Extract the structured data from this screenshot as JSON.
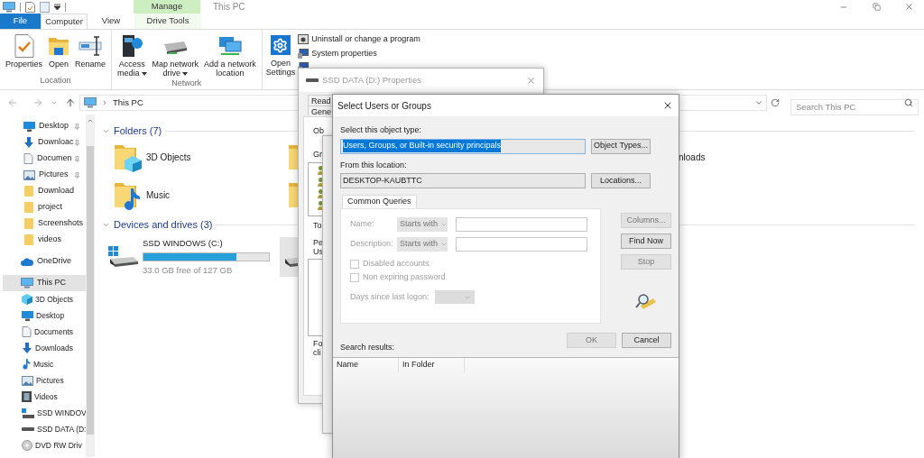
{
  "explorer": {
    "title": "This PC",
    "context_group": "Manage",
    "tabs": [
      {
        "label": "File",
        "kind": "file",
        "selected": false
      },
      {
        "label": "Computer",
        "kind": "tab",
        "selected": true
      },
      {
        "label": "View",
        "kind": "tab",
        "selected": false
      },
      {
        "label": "Drive Tools",
        "kind": "context",
        "selected": false
      }
    ],
    "ribbon_groups": [
      {
        "label": "Location",
        "commands": [
          {
            "label": "Properties",
            "kind": "properties",
            "has_menu": false
          },
          {
            "label": "Open",
            "kind": "open",
            "has_menu": false
          },
          {
            "label": "Rename",
            "kind": "rename",
            "has_menu": false
          }
        ]
      },
      {
        "label": "Network",
        "commands": [
          {
            "label": "Access\nmedia",
            "kind": "media",
            "has_menu": true
          },
          {
            "label": "Map network\ndrive",
            "kind": "map_drive",
            "has_menu": true
          },
          {
            "label": "Add a network\nlocation",
            "kind": "network_location",
            "has_menu": false
          }
        ]
      }
    ],
    "settings_command": "Open\nSettings",
    "system_commands": [
      {
        "label": "Uninstall or change a program",
        "kind": "uninstall"
      },
      {
        "label": "System properties",
        "kind": "system"
      }
    ],
    "address": "This PC",
    "search_placeholder": "Search This PC",
    "quick_access": [
      {
        "label": "Desktop",
        "kind": "desktop",
        "pinned": true
      },
      {
        "label": "Downloac",
        "kind": "download",
        "pinned": true
      },
      {
        "label": "Documen",
        "kind": "document",
        "pinned": true
      },
      {
        "label": "Pictures",
        "kind": "pictures",
        "pinned": true
      },
      {
        "label": "Download",
        "kind": "folder",
        "pinned": false
      },
      {
        "label": "project",
        "kind": "folder",
        "pinned": false
      },
      {
        "label": "Screenshots",
        "kind": "folder",
        "pinned": false
      },
      {
        "label": "videos",
        "kind": "folder",
        "pinned": false
      }
    ],
    "nav_roots": [
      {
        "label": "OneDrive",
        "kind": "cloud",
        "selected": false
      },
      {
        "label": "This PC",
        "kind": "pc",
        "selected": true,
        "children": [
          {
            "label": "3D Objects",
            "kind": "cube",
            "selected": false
          },
          {
            "label": "Desktop",
            "kind": "desktop",
            "selected": false
          },
          {
            "label": "Documents",
            "kind": "document",
            "selected": false
          },
          {
            "label": "Downloads",
            "kind": "download",
            "selected": false
          },
          {
            "label": "Music",
            "kind": "music",
            "selected": false
          },
          {
            "label": "Pictures",
            "kind": "pictures",
            "selected": false
          },
          {
            "label": "Videos",
            "kind": "videos",
            "selected": false
          },
          {
            "label": "SSD WINDOV",
            "kind": "drive_windows",
            "selected": false
          },
          {
            "label": "SSD DATA (D:",
            "kind": "drive",
            "selected": false
          },
          {
            "label": "DVD RW Driv",
            "kind": "dvd",
            "selected": false
          }
        ]
      }
    ],
    "sections": [
      {
        "title": "Folders (7)",
        "expanded": true
      },
      {
        "title": "Devices and drives (3)",
        "expanded": true
      }
    ],
    "folders": [
      {
        "label": "3D Objects",
        "kind": "cube"
      },
      {
        "label": "Music",
        "kind": "music"
      }
    ],
    "folder_label_partial": "nloads",
    "drives": [
      {
        "label": "SSD WINDOWS (C:)",
        "level": 0.74,
        "free": "33.0 GB free of 127 GB",
        "selected": false
      },
      {
        "selected": true
      }
    ]
  },
  "properties_dialog": {
    "title": "SSD DATA (D:) Properties",
    "tabs": [
      "Read",
      "Gene"
    ],
    "object_label": "Ob",
    "group_label": "Gr",
    "tip_label": "To",
    "permissions_label": "Pe",
    "users_label": "Us",
    "footer_lines": [
      "Fo",
      "cli"
    ]
  },
  "select_dialog": {
    "title": "Select Users or Groups",
    "object_type_label": "Select this object type:",
    "object_type_value": "Users, Groups, or Built-in security principals",
    "object_type_selected": true,
    "object_type_button": "Object Types...",
    "location_label": "From this location:",
    "location_value": "DESKTOP-KAUBTTC",
    "location_button": "Locations...",
    "query_tab": {
      "label": "Common Queries",
      "selected": true
    },
    "query_fields": [
      {
        "label": "Name:",
        "operator": "Starts with",
        "disabled": true
      },
      {
        "label": "Description:",
        "operator": "Starts with",
        "disabled": true
      }
    ],
    "query_options": [
      {
        "label": "Disabled accounts",
        "checked": false,
        "disabled": true
      },
      {
        "label": "Non expiring password",
        "checked": false,
        "disabled": true
      }
    ],
    "days_filter": {
      "label": "Days since last logon:",
      "disabled": true
    },
    "side_buttons": [
      {
        "label": "Columns...",
        "disabled": true
      },
      {
        "label": "Find Now",
        "disabled": false
      },
      {
        "label": "Stop",
        "disabled": true
      }
    ],
    "ok_button": {
      "label": "OK",
      "disabled": true
    },
    "cancel_button": {
      "label": "Cancel",
      "disabled": false
    },
    "results_label": "Search results:",
    "results_columns": [
      "Name",
      "In Folder"
    ]
  }
}
